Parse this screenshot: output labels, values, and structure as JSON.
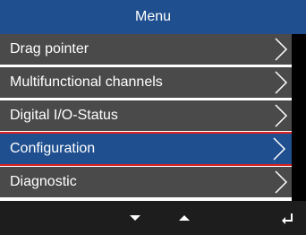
{
  "header": {
    "title": "Menu"
  },
  "menu": {
    "items": [
      {
        "label": "Drag pointer",
        "selected": false,
        "icon": "chevron-right-icon"
      },
      {
        "label": "Multifunctional channels",
        "selected": false,
        "icon": "chevron-right-icon"
      },
      {
        "label": "Digital I/O-Status",
        "selected": false,
        "icon": "chevron-right-icon"
      },
      {
        "label": "Configuration",
        "selected": true,
        "icon": "chevron-right-icon"
      },
      {
        "label": "Diagnostic",
        "selected": false,
        "icon": "chevron-right-icon"
      }
    ]
  },
  "footer": {
    "buttons": [
      {
        "icon": "arrow-down-icon"
      },
      {
        "icon": "arrow-up-icon"
      },
      {
        "icon": "enter-icon"
      }
    ]
  },
  "colors": {
    "header_bg": "#1f4f8f",
    "item_bg": "#4a4a4a",
    "selected_bg": "#1f4f8f",
    "selection_outline": "#dd2222",
    "footer_bg": "#1d1d1d"
  }
}
